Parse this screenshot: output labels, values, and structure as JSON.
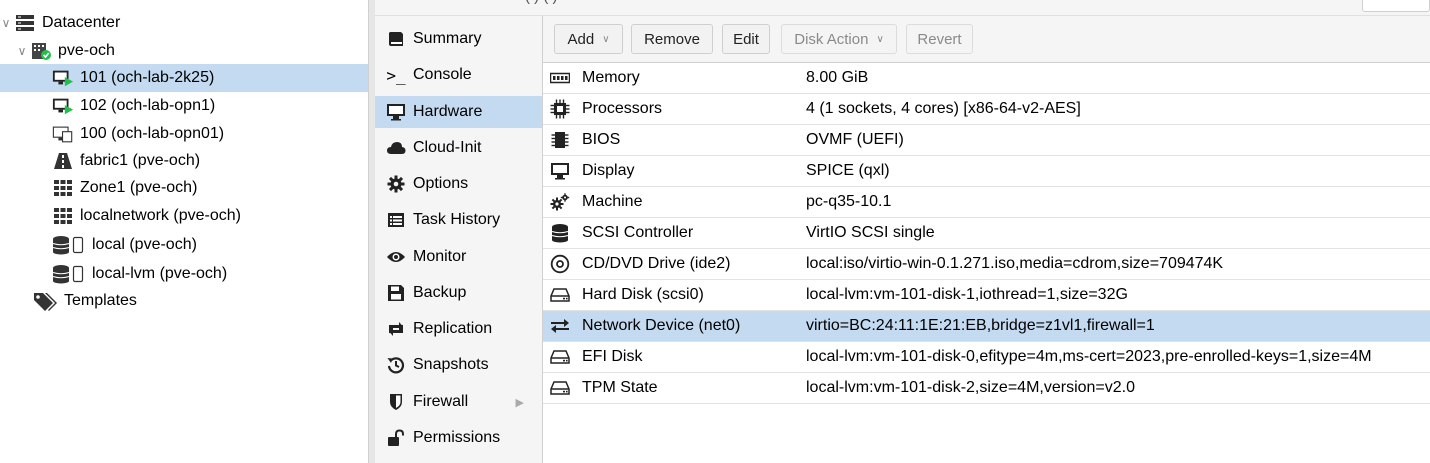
{
  "header": {
    "title_fragment": "(   ) ( )        "
  },
  "tree": {
    "items": [
      {
        "label": "Datacenter",
        "icon": "datacenter-icon"
      },
      {
        "label": "pve-och",
        "icon": "node-online-icon"
      },
      {
        "label": "101 (och-lab-2k25)",
        "icon": "vm-running-icon"
      },
      {
        "label": "102 (och-lab-opn1)",
        "icon": "vm-running-icon"
      },
      {
        "label": "100 (och-lab-opn01)",
        "icon": "vm-stopped-icon"
      },
      {
        "label": "fabric1 (pve-och)",
        "icon": "fabric-icon"
      },
      {
        "label": "Zone1 (pve-och)",
        "icon": "zone-icon"
      },
      {
        "label": "localnetwork (pve-och)",
        "icon": "zone-icon"
      },
      {
        "label": "local (pve-och)",
        "icon": "storage-icon"
      },
      {
        "label": "local-lvm (pve-och)",
        "icon": "storage-icon"
      },
      {
        "label": "Templates",
        "icon": "tags-icon"
      }
    ]
  },
  "nav": {
    "items": [
      {
        "label": "Summary",
        "icon": "book-icon"
      },
      {
        "label": "Console",
        "icon": "terminal-icon"
      },
      {
        "label": "Hardware",
        "icon": "desktop-icon"
      },
      {
        "label": "Cloud-Init",
        "icon": "cloud-icon"
      },
      {
        "label": "Options",
        "icon": "gear-icon"
      },
      {
        "label": "Task History",
        "icon": "list-icon"
      },
      {
        "label": "Monitor",
        "icon": "eye-icon"
      },
      {
        "label": "Backup",
        "icon": "floppy-icon"
      },
      {
        "label": "Replication",
        "icon": "retweet-icon"
      },
      {
        "label": "Snapshots",
        "icon": "history-icon"
      },
      {
        "label": "Firewall",
        "icon": "shield-icon"
      },
      {
        "label": "Permissions",
        "icon": "unlock-icon"
      }
    ],
    "selected": "Hardware"
  },
  "toolbar": {
    "add_label": "Add",
    "remove_label": "Remove",
    "edit_label": "Edit",
    "disk_action_label": "Disk Action",
    "revert_label": "Revert"
  },
  "hardware": {
    "rows": [
      {
        "name": "Memory",
        "value": "8.00 GiB",
        "icon": "memory-icon"
      },
      {
        "name": "Processors",
        "value": "4 (1 sockets, 4 cores) [x86-64-v2-AES]",
        "icon": "cpu-icon"
      },
      {
        "name": "BIOS",
        "value": "OVMF (UEFI)",
        "icon": "microchip-icon"
      },
      {
        "name": "Display",
        "value": "SPICE (qxl)",
        "icon": "display-icon"
      },
      {
        "name": "Machine",
        "value": "pc-q35-10.1",
        "icon": "cogs-icon"
      },
      {
        "name": "SCSI Controller",
        "value": "VirtIO SCSI single",
        "icon": "database-icon"
      },
      {
        "name": "CD/DVD Drive (ide2)",
        "value": "local:iso/virtio-win-0.1.271.iso,media=cdrom,size=709474K",
        "icon": "cdrom-icon"
      },
      {
        "name": "Hard Disk (scsi0)",
        "value": "local-lvm:vm-101-disk-1,iothread=1,size=32G",
        "icon": "hdd-icon"
      },
      {
        "name": "Network Device (net0)",
        "value": "virtio=BC:24:11:1E:21:EB,bridge=z1vl1,firewall=1",
        "icon": "exchange-icon"
      },
      {
        "name": "EFI Disk",
        "value": "local-lvm:vm-101-disk-0,efitype=4m,ms-cert=2023,pre-enrolled-keys=1,size=4M",
        "icon": "hdd-icon"
      },
      {
        "name": "TPM State",
        "value": "local-lvm:vm-101-disk-2,size=4M,version=v2.0",
        "icon": "hdd-icon"
      }
    ],
    "selected": "Network Device (net0)"
  },
  "colors": {
    "selection": "#c3daf0",
    "running": "#21bf4b",
    "panel": "#f5f5f5"
  }
}
